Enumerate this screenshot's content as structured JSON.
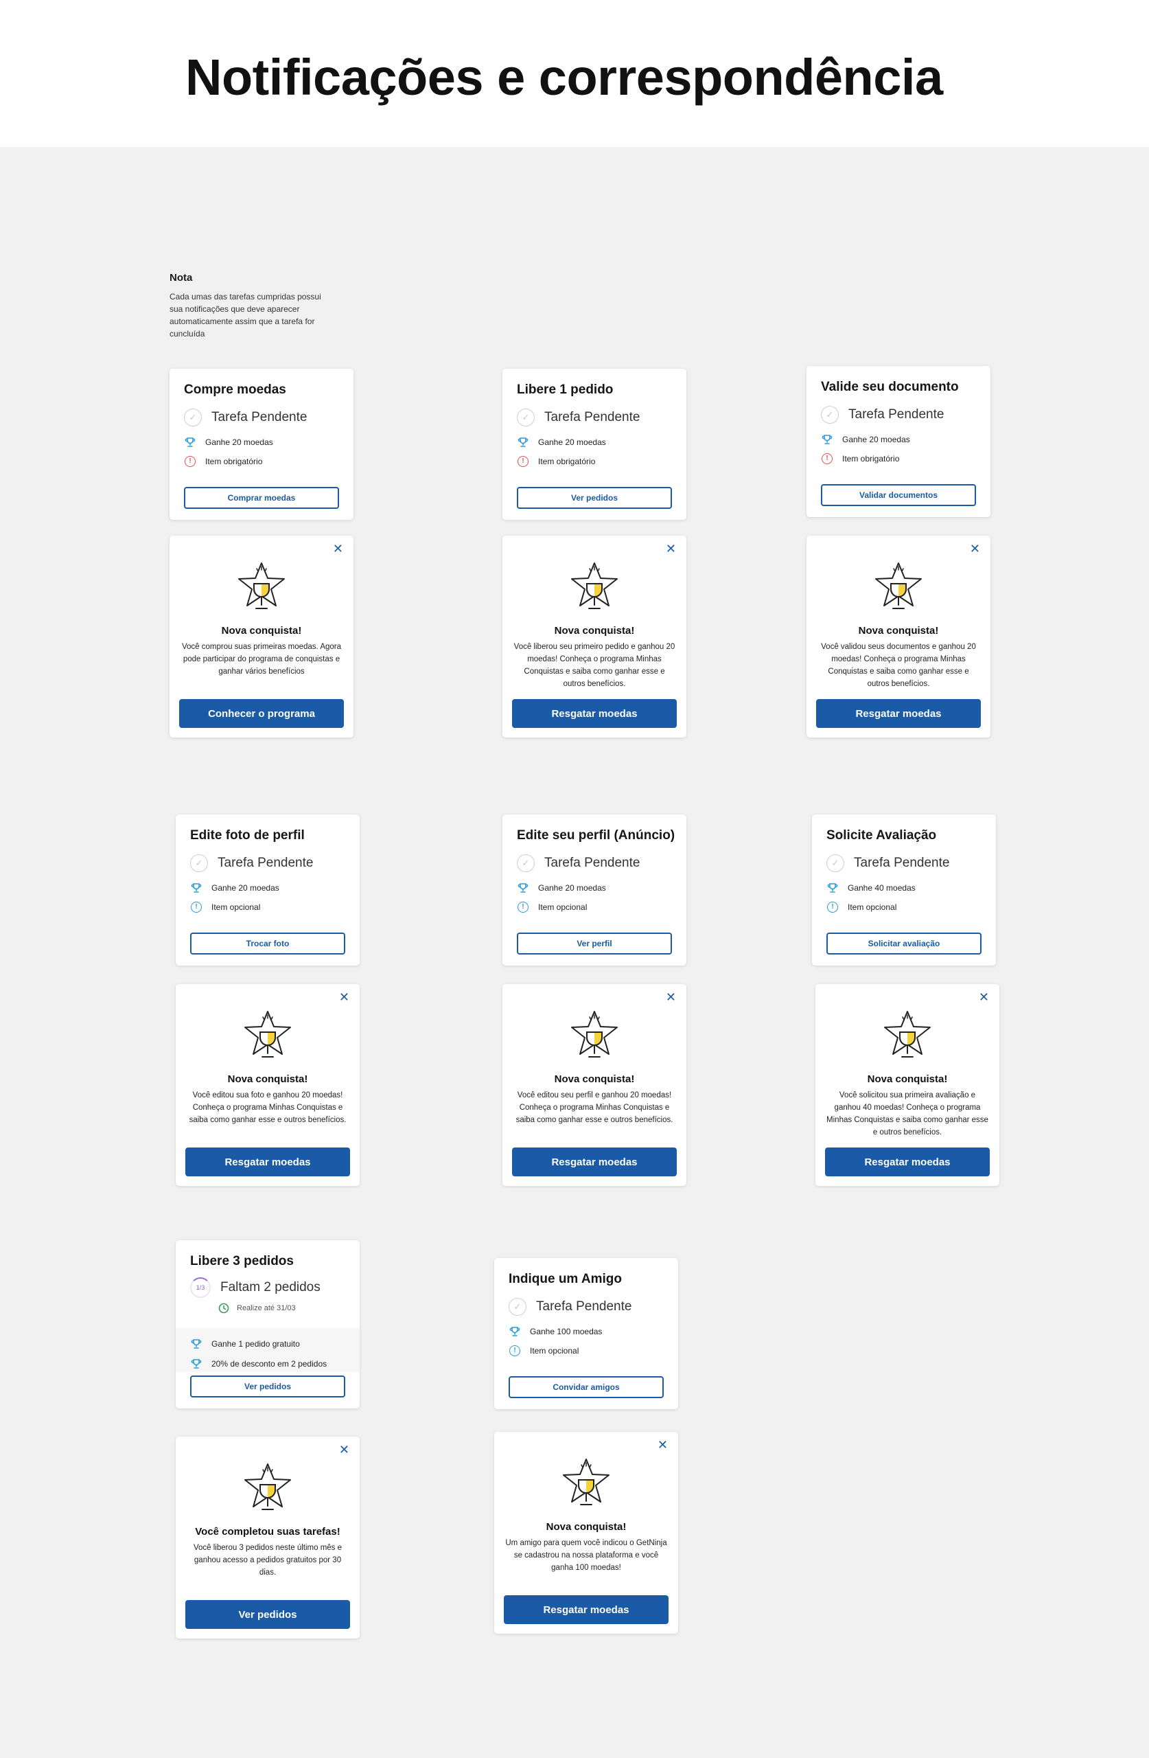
{
  "page": {
    "title": "Notificações e correspondência",
    "note_title": "Nota",
    "note_body": "Cada umas das tarefas cumpridas possui sua notificações que deve aparecer automaticamente assim que a tarefa for cuncluída"
  },
  "tasks": [
    {
      "title": "Compre moedas",
      "status": "Tarefa Pendente",
      "reward": "Ganhe 20 moedas",
      "requirement": "Item obrigatório",
      "requirement_type": "required",
      "button": "Comprar moedas"
    },
    {
      "title": "Libere 1 pedido",
      "status": "Tarefa Pendente",
      "reward": "Ganhe 20 moedas",
      "requirement": "Item obrigatório",
      "requirement_type": "required",
      "button": "Ver pedidos"
    },
    {
      "title": "Valide seu documento",
      "status": "Tarefa Pendente",
      "reward": "Ganhe 20 moedas",
      "requirement": "Item obrigatório",
      "requirement_type": "required",
      "button": "Validar documentos"
    },
    {
      "title": "Edite foto de perfil",
      "status": "Tarefa Pendente",
      "reward": "Ganhe 20 moedas",
      "requirement": "Item opcional",
      "requirement_type": "optional",
      "button": "Trocar foto"
    },
    {
      "title": "Edite seu perfil (Anúncio)",
      "status": "Tarefa Pendente",
      "reward": "Ganhe 20 moedas",
      "requirement": "Item opcional",
      "requirement_type": "optional",
      "button": "Ver perfil"
    },
    {
      "title": "Solicite Avaliação",
      "status": "Tarefa Pendente",
      "reward": "Ganhe 40 moedas",
      "requirement": "Item opcional",
      "requirement_type": "optional",
      "button": "Solicitar avaliação"
    },
    {
      "title": "Indique um Amigo",
      "status": "Tarefa Pendente",
      "reward": "Ganhe 100 moedas",
      "requirement": "Item opcional",
      "requirement_type": "optional",
      "button": "Convidar amigos"
    }
  ],
  "progress_task": {
    "title": "Libere 3 pedidos",
    "progress_label": "1/3",
    "progress": 0.33,
    "status": "Faltam 2 pedidos",
    "deadline": "Realize até 31/03",
    "reward1": "Ganhe 1 pedido gratuito",
    "reward2": "20% de desconto em 2 pedidos",
    "button": "Ver pedidos"
  },
  "achievements": [
    {
      "title": "Nova conquista!",
      "body": "Você comprou suas primeiras moedas. Agora pode participar do programa de conquistas e ganhar vários benefícios",
      "button": "Conhecer o programa"
    },
    {
      "title": "Nova conquista!",
      "body": "Você liberou seu primeiro pedido e ganhou 20 moedas! Conheça o programa Minhas Conquistas e saiba como ganhar esse e outros benefícios.",
      "button": "Resgatar moedas"
    },
    {
      "title": "Nova conquista!",
      "body": "Você validou seus documentos e ganhou 20 moedas! Conheça o programa Minhas Conquistas e saiba como ganhar esse e outros benefícios.",
      "button": "Resgatar moedas"
    },
    {
      "title": "Nova conquista!",
      "body": "Você editou sua foto e ganhou 20 moedas! Conheça o programa Minhas Conquistas e saiba como ganhar esse e outros benefícios.",
      "button": "Resgatar moedas"
    },
    {
      "title": "Nova conquista!",
      "body": "Você editou seu perfil e ganhou 20 moedas! Conheça o programa Minhas Conquistas e saiba como ganhar esse e outros benefícios.",
      "button": "Resgatar moedas"
    },
    {
      "title": "Nova conquista!",
      "body": "Você solicitou sua primeira avaliação e ganhou 40 moedas! Conheça o programa Minhas Conquistas e saiba como ganhar esse e outros benefícios.",
      "button": "Resgatar moedas"
    },
    {
      "title": "Você completou suas tarefas!",
      "body": "Você liberou 3 pedidos neste último mês e ganhou acesso a pedidos gratuitos por 30 dias.",
      "button": "Ver pedidos"
    },
    {
      "title": "Nova conquista!",
      "body": "Um amigo para quem você indicou o GetNinja se cadastrou na nossa plataforma e você ganha 100 moedas!",
      "button": "Resgatar moedas"
    }
  ],
  "colors": {
    "primary": "#1b5aa6",
    "background": "#f1f1f1",
    "required": "#e0524f",
    "optional": "#2a9bd8",
    "trophy_accent": "#f5d33a"
  },
  "icons": {
    "close": "close-icon",
    "trophy": "trophy-icon",
    "check": "check-circle-icon",
    "alert": "alert-icon",
    "info": "info-icon",
    "clock": "clock-icon"
  }
}
